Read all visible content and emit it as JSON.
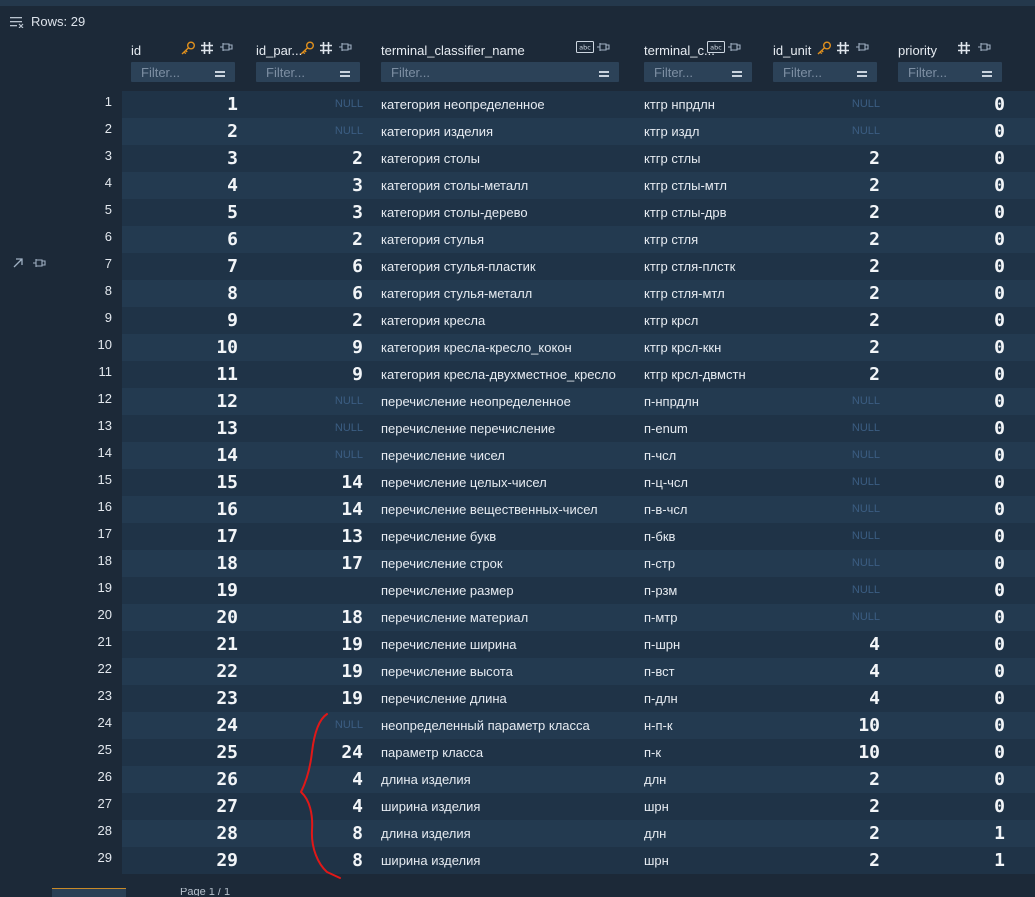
{
  "toolbar": {
    "rows_label": "Rows: 29"
  },
  "columns": [
    {
      "key": "id",
      "title": "id",
      "icons": [
        "key-icon",
        "hash-icon",
        "pin-icon"
      ],
      "filter_placeholder": "Filter..."
    },
    {
      "key": "id_parent",
      "title": "id_par...",
      "icons": [
        "key-icon",
        "hash-icon",
        "pin-icon"
      ],
      "filter_placeholder": "Filter..."
    },
    {
      "key": "name",
      "title": "terminal_classifier_name",
      "icons": [
        "text-type-icon",
        "pin-icon"
      ],
      "filter_placeholder": "Filter..."
    },
    {
      "key": "code",
      "title": "terminal_c...",
      "icons": [
        "text-type-icon",
        "pin-icon"
      ],
      "filter_placeholder": "Filter..."
    },
    {
      "key": "id_unit",
      "title": "id_unit",
      "icons": [
        "key-icon",
        "hash-icon",
        "pin-icon"
      ],
      "filter_placeholder": "Filter..."
    },
    {
      "key": "priority",
      "title": "priority",
      "icons": [
        "hash-icon",
        "pin-icon"
      ],
      "filter_placeholder": "Filter..."
    }
  ],
  "null_text": "NULL",
  "rows": [
    [
      "1",
      "1",
      null,
      "категория неопределенное",
      "ктгр нпрдлн",
      null,
      "0"
    ],
    [
      "2",
      "2",
      null,
      "категория изделия",
      "ктгр издл",
      null,
      "0"
    ],
    [
      "3",
      "3",
      "2",
      "категория столы",
      "ктгр стлы",
      "2",
      "0"
    ],
    [
      "4",
      "4",
      "3",
      "категория столы-металл",
      "ктгр стлы-мтл",
      "2",
      "0"
    ],
    [
      "5",
      "5",
      "3",
      "категория столы-дерево",
      "ктгр стлы-дрв",
      "2",
      "0"
    ],
    [
      "6",
      "6",
      "2",
      "категория стулья",
      "ктгр стля",
      "2",
      "0"
    ],
    [
      "7",
      "7",
      "6",
      "категория стулья-пластик",
      "ктгр стля-плстк",
      "2",
      "0"
    ],
    [
      "8",
      "8",
      "6",
      "категория стулья-металл",
      "ктгр стля-мтл",
      "2",
      "0"
    ],
    [
      "9",
      "9",
      "2",
      "категория кресла",
      "ктгр крсл",
      "2",
      "0"
    ],
    [
      "10",
      "10",
      "9",
      "категория кресла-кресло_кокон",
      "ктгр крсл-ккн",
      "2",
      "0"
    ],
    [
      "11",
      "11",
      "9",
      "категория кресла-двухместное_кресло",
      "ктгр крсл-двмстн",
      "2",
      "0"
    ],
    [
      "12",
      "12",
      null,
      "перечисление неопределенное",
      "п-нпрдлн",
      null,
      "0"
    ],
    [
      "13",
      "13",
      null,
      "перечисление перечисление",
      "п-enum",
      null,
      "0"
    ],
    [
      "14",
      "14",
      null,
      "перечисление чисел",
      "п-чсл",
      null,
      "0"
    ],
    [
      "15",
      "15",
      "14",
      "перечисление целых-чисел",
      "п-ц-чсл",
      null,
      "0"
    ],
    [
      "16",
      "16",
      "14",
      "перечисление вещественных-чисел",
      "п-в-чсл",
      null,
      "0"
    ],
    [
      "17",
      "17",
      "13",
      "перечисление букв",
      "п-бкв",
      null,
      "0"
    ],
    [
      "18",
      "18",
      "17",
      "перечисление строк",
      "п-стр",
      null,
      "0"
    ],
    [
      "19",
      "19",
      "",
      "перечисление размер",
      "п-рзм",
      null,
      "0"
    ],
    [
      "20",
      "20",
      "18",
      "перечисление материал",
      "п-мтр",
      null,
      "0"
    ],
    [
      "21",
      "21",
      "19",
      "перечисление ширина",
      "п-шрн",
      "4",
      "0"
    ],
    [
      "22",
      "22",
      "19",
      "перечисление высота",
      "п-вст",
      "4",
      "0"
    ],
    [
      "23",
      "23",
      "19",
      "перечисление длина",
      "п-длн",
      "4",
      "0"
    ],
    [
      "24",
      "24",
      null,
      "неопределенный параметр класса",
      "н-п-к",
      "10",
      "0"
    ],
    [
      "25",
      "25",
      "24",
      "параметр класса",
      "п-к",
      "10",
      "0"
    ],
    [
      "26",
      "26",
      "4",
      "длина изделия",
      "длн",
      "2",
      "0"
    ],
    [
      "27",
      "27",
      "4",
      "ширина изделия",
      "шрн",
      "2",
      "0"
    ],
    [
      "28",
      "28",
      "8",
      "длина изделия",
      "длн",
      "2",
      "1"
    ],
    [
      "29",
      "29",
      "8",
      "ширина изделия",
      "шрн",
      "2",
      "1"
    ]
  ],
  "footer": {
    "page_text": "Page 1 / 1"
  },
  "colors": {
    "key_icon": "#e0901e",
    "annotation": "#e01818",
    "null": "#3b5d82"
  }
}
